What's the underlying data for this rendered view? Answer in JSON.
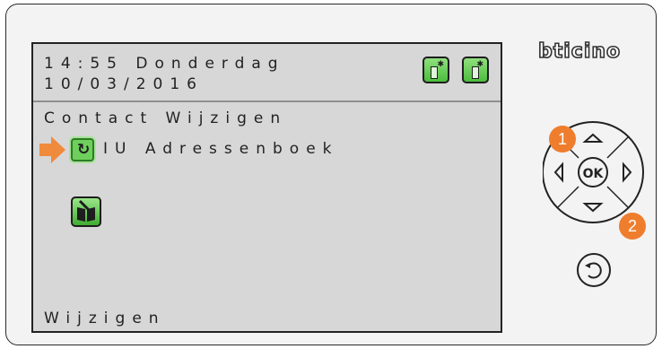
{
  "device": {
    "brand": "bticino"
  },
  "status": {
    "time_day": "14:55 Donderdag",
    "date": "10/03/2016",
    "icons": [
      "intercom-status-icon",
      "handset-status-icon"
    ]
  },
  "menu": {
    "title": "Contact Wijzigen",
    "selected_item_label": "IU Adressenboek",
    "selected_item_icon": "refresh-icon",
    "action_icon": "edit-address-book-icon",
    "footer_label": "Wijzigen"
  },
  "keypad": {
    "ok_label": "OK",
    "up_icon": "up-arrow-icon",
    "down_icon": "down-arrow-icon",
    "left_icon": "left-arrow-icon",
    "right_icon": "right-arrow-icon",
    "back_icon": "back-icon"
  },
  "callouts": [
    "1",
    "2"
  ],
  "colors": {
    "accent_orange": "#ef7d2e",
    "icon_green": "#4bbd3c",
    "screen_bg": "#d7d7d7"
  }
}
